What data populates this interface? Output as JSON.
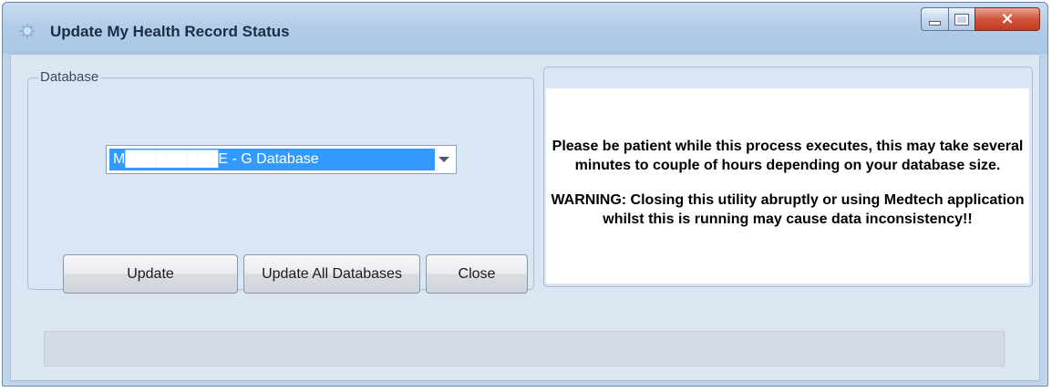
{
  "window": {
    "title": "Update My Health Record Status",
    "controls": {
      "minimize": "minimize",
      "maximize": "maximize",
      "close": "×"
    }
  },
  "database_group": {
    "legend": "Database",
    "selected_database": "M█████████E - G Database"
  },
  "buttons": {
    "update": "Update",
    "update_all": "Update All Databases",
    "close": "Close"
  },
  "message": {
    "paragraph1": "Please be patient while this process executes, this may take several minutes to couple of hours depending on your database size.",
    "paragraph2": "WARNING: Closing this utility abruptly or using Medtech application whilst this is running may cause data inconsistency!!"
  },
  "progress": {
    "value_percent": 0
  },
  "colors": {
    "title_bar": "#b3cde8",
    "selection": "#3399ff",
    "close_button": "#c23b22",
    "client_background": "#dbe6f2"
  },
  "icons": [
    "app-icon",
    "minimize-icon",
    "maximize-icon",
    "close-icon",
    "dropdown-arrow-icon"
  ]
}
